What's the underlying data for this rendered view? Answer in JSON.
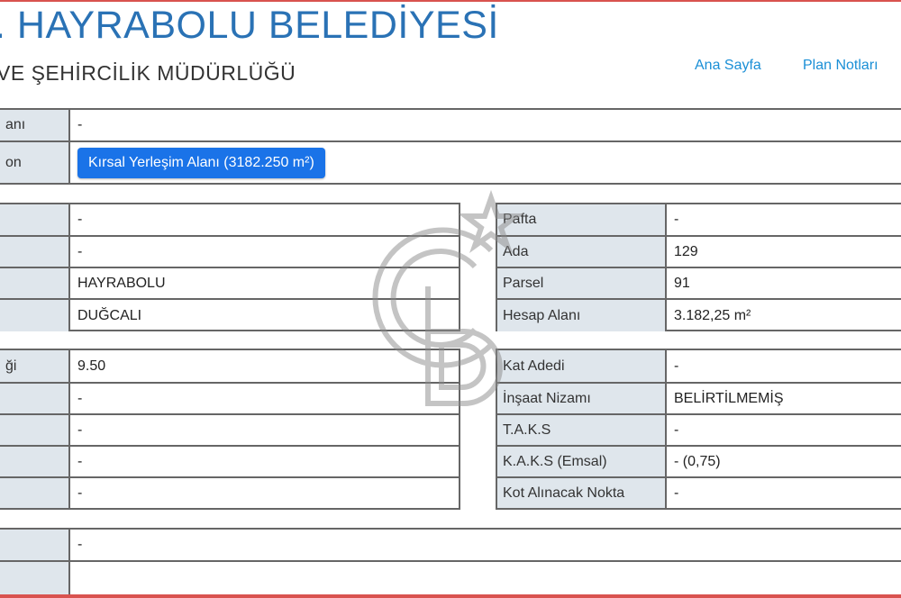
{
  "header": {
    "title": ". HAYRABOLU BELEDİYESİ",
    "subtitle": "VE ŞEHİRCİLİK MÜDÜRLÜĞÜ",
    "nav": [
      "Ana Sayfa",
      "Plan Notları"
    ]
  },
  "top_panel": {
    "rows": [
      {
        "label": "anı",
        "value": "-"
      },
      {
        "label": "on",
        "button": "Kırsal Yerleşim Alanı (3182.250 m²)"
      }
    ]
  },
  "left_panel_1": {
    "rows": [
      {
        "label": "",
        "value": "-"
      },
      {
        "label": "",
        "value": "-"
      },
      {
        "label": "",
        "value": "HAYRABOLU"
      },
      {
        "label": "",
        "value": "DUĞCALI"
      }
    ]
  },
  "right_panel_1": {
    "rows": [
      {
        "label": "Pafta",
        "value": "-"
      },
      {
        "label": "Ada",
        "value": "129"
      },
      {
        "label": "Parsel",
        "value": "91"
      },
      {
        "label": "Hesap Alanı",
        "value": "3.182,25 m²"
      }
    ]
  },
  "left_panel_2": {
    "rows": [
      {
        "label": "ği",
        "value": "9.50"
      },
      {
        "label": "",
        "value": "-"
      },
      {
        "label": "",
        "value": "-"
      },
      {
        "label": "",
        "value": "-"
      },
      {
        "label": "",
        "value": "-"
      }
    ]
  },
  "right_panel_2": {
    "rows": [
      {
        "label": "Kat Adedi",
        "value": "-"
      },
      {
        "label": "İnşaat Nizamı",
        "value": "BELİRTİLMEMİŞ"
      },
      {
        "label": "T.A.K.S",
        "value": "-"
      },
      {
        "label": "K.A.K.S (Emsal)",
        "value": "- (0,75)"
      },
      {
        "label": "Kot Alınacak Nokta",
        "value": "-"
      }
    ]
  },
  "bottom_panel": {
    "rows": [
      {
        "label": "",
        "value": "-"
      },
      {
        "label": "",
        "value": ""
      }
    ]
  },
  "watermark": {
    "icon": "cb-logo-watermark",
    "color": "#8a8a8a"
  },
  "colors": {
    "accent": "#2a72b5",
    "button": "#1a73e8",
    "label_bg": "#dfe6ec",
    "border": "#666666",
    "frame": "#d9534f"
  }
}
